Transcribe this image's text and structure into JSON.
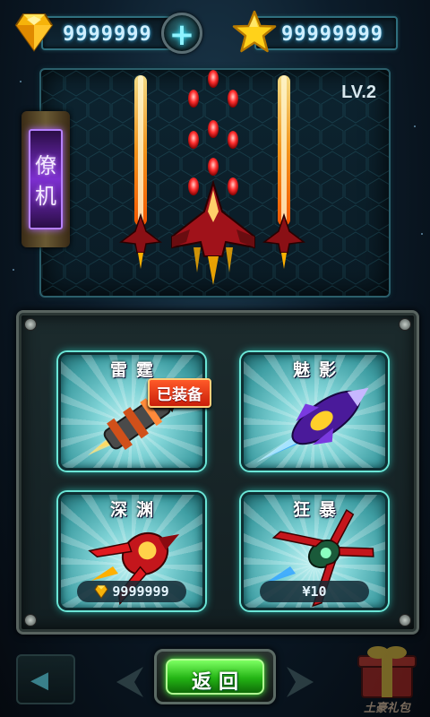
{
  "currency": {
    "gems": "9999999",
    "stars": "99999999",
    "add_label": "+"
  },
  "preview": {
    "level": "LV.2",
    "wingman_tab": "僚机"
  },
  "wingmen": [
    {
      "name": "雷霆",
      "badge": "已装备",
      "price": ""
    },
    {
      "name": "魅影",
      "badge": "",
      "price": ""
    },
    {
      "name": "深渊",
      "badge": "",
      "price": "9999999"
    },
    {
      "name": "狂暴",
      "badge": "",
      "price": "¥10"
    }
  ],
  "footer": {
    "return_label": "返回",
    "gift_label": "土豪礼包"
  },
  "icons": [
    "gem-icon",
    "star-icon",
    "plus-icon",
    "back-arrow-icon",
    "gift-icon"
  ],
  "colors": {
    "accent_teal": "#6be5d6",
    "button_green": "#23b414",
    "badge_red": "#c91e0a",
    "tab_purple": "#7d2fd0"
  }
}
